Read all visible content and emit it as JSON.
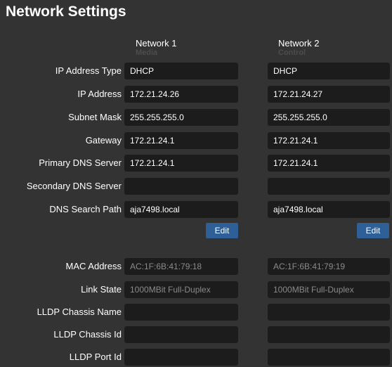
{
  "page_title": "Network Settings",
  "columns": [
    {
      "title": "Network 1",
      "subtitle": "Media"
    },
    {
      "title": "Network 2",
      "subtitle": "Control"
    }
  ],
  "rows": [
    {
      "label": "IP Address Type",
      "n1": "DHCP",
      "n2": "DHCP"
    },
    {
      "label": "IP Address",
      "n1": "172.21.24.26",
      "n2": "172.21.24.27"
    },
    {
      "label": "Subnet Mask",
      "n1": "255.255.255.0",
      "n2": "255.255.255.0"
    },
    {
      "label": "Gateway",
      "n1": "172.21.24.1",
      "n2": "172.21.24.1"
    },
    {
      "label": "Primary DNS Server",
      "n1": "172.21.24.1",
      "n2": "172.21.24.1"
    },
    {
      "label": "Secondary DNS Server",
      "n1": "",
      "n2": ""
    },
    {
      "label": "DNS Search Path",
      "n1": "aja7498.local",
      "n2": "aja7498.local"
    }
  ],
  "edit_label": "Edit",
  "info_rows": [
    {
      "label": "MAC Address",
      "n1": "AC:1F:6B:41:79:18",
      "n2": "AC:1F:6B:41:79:19"
    },
    {
      "label": "Link State",
      "n1": "1000MBit Full-Duplex",
      "n2": "1000MBit Full-Duplex"
    },
    {
      "label": "LLDP Chassis Name",
      "n1": "",
      "n2": ""
    },
    {
      "label": "LLDP Chassis Id",
      "n1": "",
      "n2": ""
    },
    {
      "label": "LLDP Port Id",
      "n1": "",
      "n2": ""
    }
  ]
}
